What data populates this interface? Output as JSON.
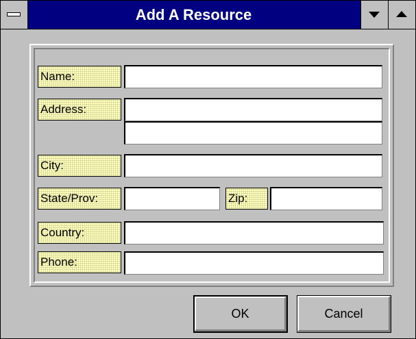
{
  "window": {
    "title": "Add A Resource"
  },
  "form": {
    "name": {
      "label": "Name:",
      "value": ""
    },
    "address": {
      "label": "Address:",
      "line1": "",
      "line2": ""
    },
    "city": {
      "label": "City:",
      "value": ""
    },
    "state": {
      "label": "State/Prov:",
      "value": ""
    },
    "zip": {
      "label": "Zip:",
      "value": ""
    },
    "country": {
      "label": "Country:",
      "value": ""
    },
    "phone": {
      "label": "Phone:",
      "value": ""
    }
  },
  "buttons": {
    "ok": "OK",
    "cancel": "Cancel"
  },
  "colors": {
    "title_bar": "#000080",
    "dialog_face": "#c0c0c0",
    "label_background": "#ffffc0"
  },
  "icons": {
    "system_menu": "system-menu-icon",
    "minimize": "minimize-icon",
    "maximize": "maximize-icon"
  }
}
